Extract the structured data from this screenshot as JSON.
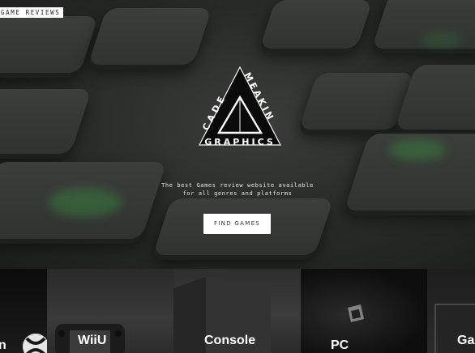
{
  "brand_tag": "GAME REVIEWS",
  "logo": {
    "left_text": "CADE",
    "right_text": "MEAKIN",
    "bottom_text": "GRAPHICS"
  },
  "hero": {
    "tagline_line1": "The best Games review website available",
    "tagline_line2": "for all genres and platforms",
    "cta_label": "FIND GAMES"
  },
  "categories": [
    {
      "label": "n"
    },
    {
      "label": "WiiU"
    },
    {
      "label": "Console"
    },
    {
      "label": "PC"
    },
    {
      "label": "Gar"
    }
  ],
  "colors": {
    "glow_green": "#3cbe46",
    "button_bg": "#ffffff",
    "text_light": "#e8e8e8"
  }
}
